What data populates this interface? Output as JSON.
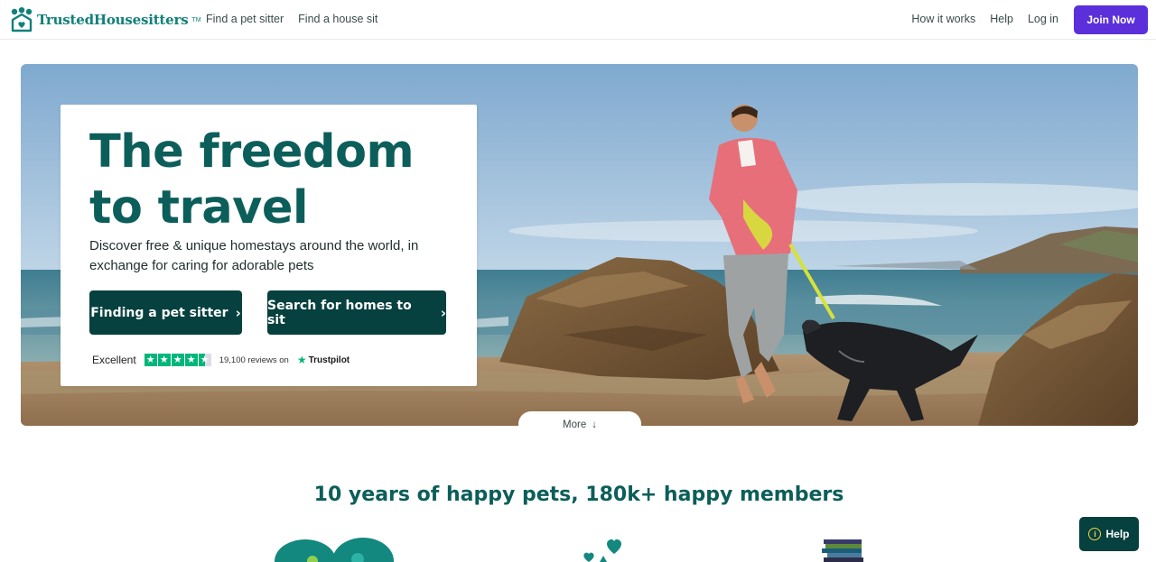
{
  "header": {
    "brand": "TrustedHousesitters",
    "brand_mark": "TM",
    "nav_left": [
      {
        "label": "Find a pet sitter"
      },
      {
        "label": "Find a house sit"
      }
    ],
    "nav_right": [
      {
        "label": "How it works"
      },
      {
        "label": "Help"
      },
      {
        "label": "Log in"
      }
    ],
    "join_label": "Join Now"
  },
  "hero": {
    "headline": "The freedom to travel",
    "subline": "Discover free & unique homestays around the world, in exchange for caring for adorable pets",
    "cta_primary": "Finding a pet sitter",
    "cta_secondary": "Search for homes to sit",
    "trust": {
      "rating_word": "Excellent",
      "rating_stars": 4.5,
      "reviews": "19,100 reviews on",
      "provider": "Trustpilot"
    },
    "more_label": "More"
  },
  "stats": {
    "title": "10 years of happy pets, 180k+ happy members"
  },
  "help_button": "Help",
  "colors": {
    "brand_teal": "#11807a",
    "headline_teal": "#0c5e5a",
    "cta_dark": "#06403f",
    "join_purple": "#5b2fd9",
    "trustpilot_green": "#00b67a"
  },
  "icons": [
    "paw-heart-logo-icon",
    "chevron-right-icon",
    "arrow-down-icon",
    "trustpilot-star-icon",
    "info-icon",
    "stats-illustration-icon"
  ]
}
